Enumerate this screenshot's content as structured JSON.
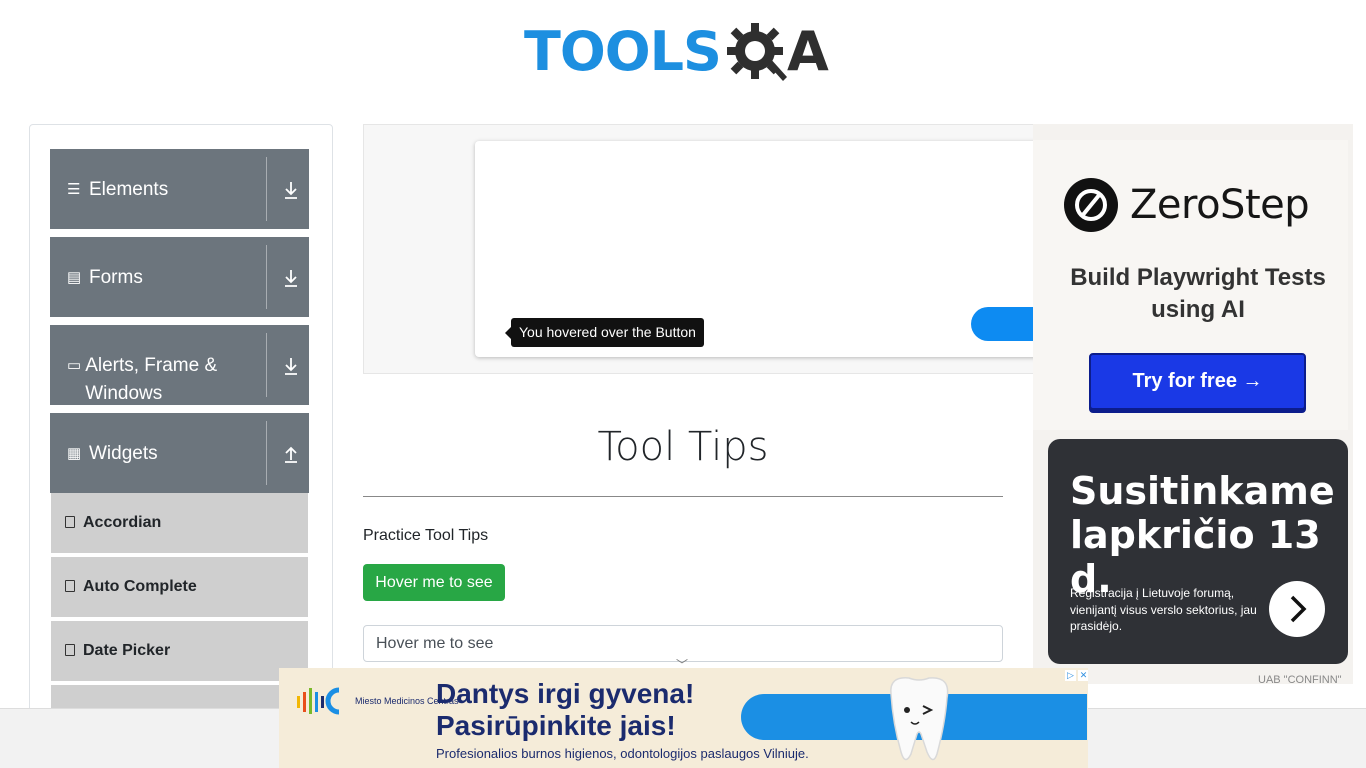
{
  "sidebar": {
    "groups": [
      {
        "label": "Elements",
        "icon": "list-icon",
        "expanded": false
      },
      {
        "label": "Forms",
        "icon": "document-icon",
        "expanded": false
      },
      {
        "label": "Alerts, Frame & Windows",
        "icon": "window-icon",
        "expanded": false
      },
      {
        "label": "Widgets",
        "icon": "grid-icon",
        "expanded": true
      }
    ],
    "widget_items": [
      "Accordian",
      "Auto Complete",
      "Date Picker"
    ]
  },
  "demo": {
    "tooltip_text": "You hovered over the Button"
  },
  "main": {
    "title": "Tool Tips",
    "practice_label": "Practice Tool Tips",
    "hover_button_label": "Hover me to see",
    "hover_input_value": "Hover me to see"
  },
  "ads": {
    "zerostep": {
      "brand": "ZeroStep",
      "tagline": "Build Playwright Tests using AI",
      "cta": "Try for free →"
    },
    "confinn": {
      "headline": "Susitinkame lapkričio 13 d.",
      "body": "Registracija į Lietuvoje forumą, vienijantį visus verslo sektorius, jau prasidėjo.",
      "advertiser": "UAB \"CONFINN\""
    },
    "bottom": {
      "logo_name": "Miesto Medicinos Centras",
      "headline_line1": "Dantys irgi gyvena!",
      "headline_line2": "Pasirūpinkite jais!",
      "subline": "Profesionalios burnos higienos, odontologijos paslaugos Vilniuje."
    }
  },
  "colors": {
    "accent_blue": "#1d8fe0",
    "sidebar_group": "#6c757d",
    "sidebar_sub": "#cfcfcf",
    "success_green": "#28a745"
  }
}
